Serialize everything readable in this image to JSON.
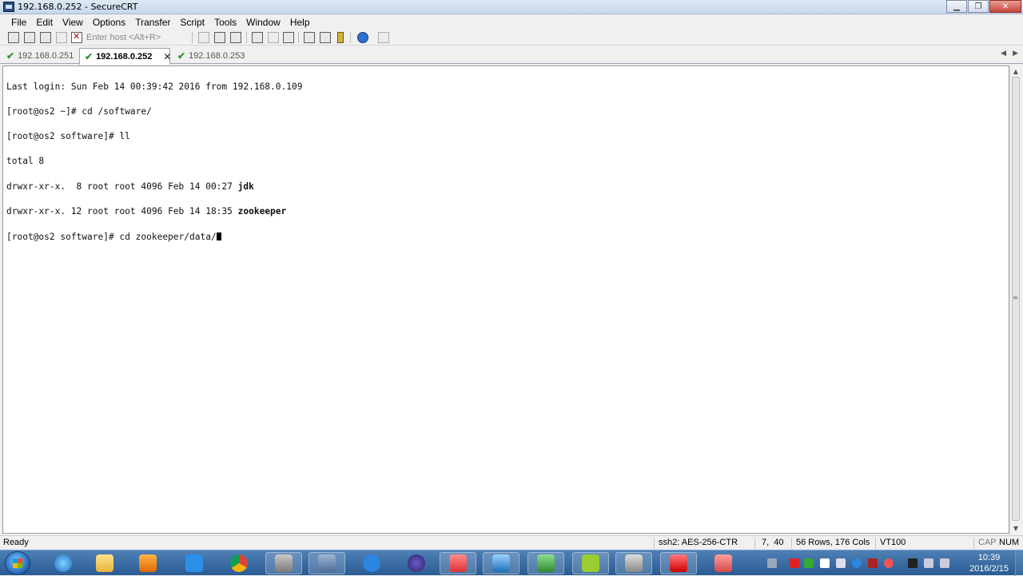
{
  "window": {
    "title": "192.168.0.252 - SecureCRT"
  },
  "menu": [
    "File",
    "Edit",
    "View",
    "Options",
    "Transfer",
    "Script",
    "Tools",
    "Window",
    "Help"
  ],
  "toolbar": {
    "host_placeholder": "Enter host <Alt+R>"
  },
  "tabs": [
    {
      "label": "192.168.0.251",
      "active": false
    },
    {
      "label": "192.168.0.252",
      "active": true
    },
    {
      "label": "192.168.0.253",
      "active": false
    }
  ],
  "terminal": {
    "lines": [
      "Last login: Sun Feb 14 00:39:42 2016 from 192.168.0.109",
      "[root@os2 ~]# cd /software/",
      "[root@os2 software]# ll",
      "total 8",
      "drwxr-xr-x.  8 root root 4096 Feb 14 00:27 ",
      "drwxr-xr-x. 12 root root 4096 Feb 14 18:35 ",
      "[root@os2 software]# cd zookeeper/data/"
    ],
    "dir_names": [
      "jdk",
      "zookeeper"
    ]
  },
  "status": {
    "ready": "Ready",
    "encryption": "ssh2: AES-256-CTR",
    "cursor_pos": "7,  40",
    "size": "56 Rows, 176 Cols",
    "emulation": "VT100",
    "cap": "CAP",
    "num": "NUM"
  },
  "taskbar": {
    "time": "10:39",
    "date": "2016/2/15"
  }
}
